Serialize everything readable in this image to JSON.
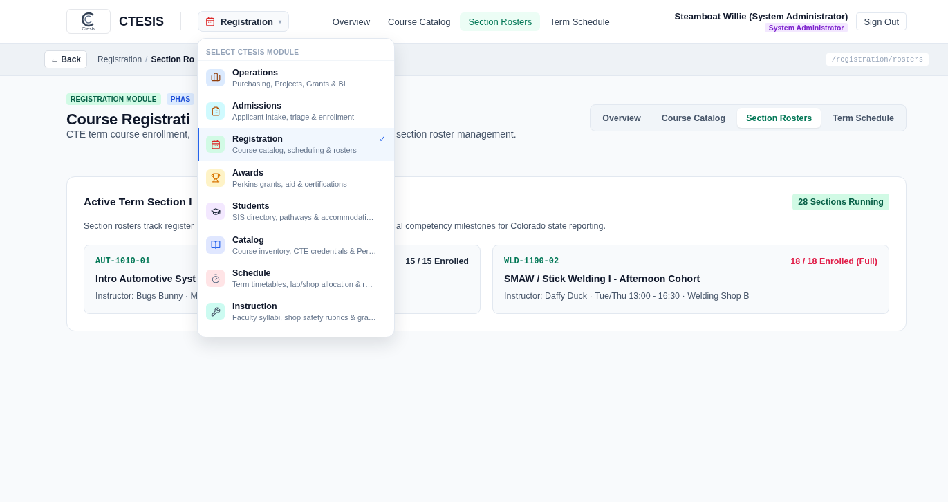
{
  "header": {
    "logo_caption": "Ctesis",
    "brand": "CTESIS",
    "module_button": {
      "label": "Registration",
      "caret": "▾"
    },
    "nav": [
      {
        "label": "Overview",
        "selected": false
      },
      {
        "label": "Course Catalog",
        "selected": false
      },
      {
        "label": "Section Rosters",
        "selected": true
      },
      {
        "label": "Term Schedule",
        "selected": false
      }
    ],
    "user": {
      "name": "Steamboat Willie (System Administrator)",
      "role": "System Administrator"
    },
    "sign_out": "Sign Out"
  },
  "subbar": {
    "back": "← Back",
    "breadcrumb": [
      "Registration",
      "Section Ro"
    ],
    "separator": "/",
    "path": "/registration/rosters"
  },
  "page": {
    "badges": [
      {
        "label": "REGISTRATION MODULE",
        "color": "#d1fae5"
      },
      {
        "label": "PHAS",
        "color": "#dbeafe"
      }
    ],
    "title": "Course Registrati",
    "subtitle_parts": [
      "CTE term course enrollment,",
      "section roster management."
    ],
    "tabs": [
      {
        "label": "Overview",
        "selected": false
      },
      {
        "label": "Course Catalog",
        "selected": false
      },
      {
        "label": "Section Rosters",
        "selected": true
      },
      {
        "label": "Term Schedule",
        "selected": false
      }
    ]
  },
  "panel": {
    "title": "Active Term Section I",
    "count_badge": "28 Sections Running",
    "description_parts": [
      "Section rosters track register",
      "al competency milestones for Colorado state reporting."
    ],
    "sections": [
      {
        "code": "AUT-1010-01",
        "status": "15 / 15 Enrolled",
        "full": false,
        "title": "Intro Automotive Syst",
        "meta": "Instructor: Bugs Bunny · M"
      },
      {
        "code": "WLD-1100-02",
        "status": "18 / 18 Enrolled (Full)",
        "full": true,
        "title": "SMAW / Stick Welding I - Afternoon Cohort",
        "meta": "Instructor: Daffy Duck · Tue/Thu 13:00 - 16:30 · Welding Shop B"
      }
    ]
  },
  "dropdown": {
    "heading": "SELECT CTESIS MODULE",
    "check_mark": "✓",
    "items": [
      {
        "name": "Operations",
        "description": "Purchasing, Projects, Grants & BI",
        "color": "#dbeafe",
        "selected": false
      },
      {
        "name": "Admissions",
        "description": "Applicant intake, triage & enrollment",
        "color": "#cffafe",
        "selected": false
      },
      {
        "name": "Registration",
        "description": "Course catalog, scheduling & rosters",
        "color": "#d1fae5",
        "selected": true
      },
      {
        "name": "Awards",
        "description": "Perkins grants, aid & certifications",
        "color": "#fef3c7",
        "selected": false
      },
      {
        "name": "Students",
        "description": "SIS directory, pathways & accommodati…",
        "color": "#f3e8ff",
        "selected": false
      },
      {
        "name": "Catalog",
        "description": "Course inventory, CTE credentials & Per…",
        "color": "#e0e7ff",
        "selected": false
      },
      {
        "name": "Schedule",
        "description": "Term timetables, lab/shop allocation & r…",
        "color": "#ffe4e6",
        "selected": false
      },
      {
        "name": "Instruction",
        "description": "Faculty syllabi, shop safety rubrics & gra…",
        "color": "#ccfbf1",
        "selected": false
      }
    ]
  }
}
